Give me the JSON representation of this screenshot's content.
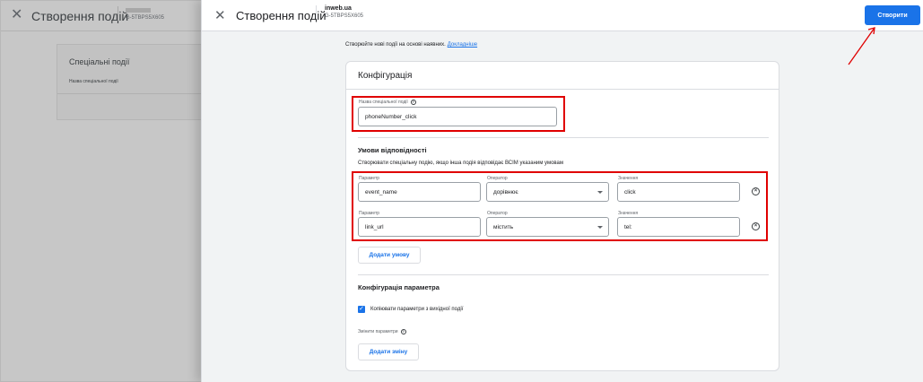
{
  "background": {
    "title": "Створення подій",
    "property_id": "G-5TBPS5X605",
    "card_title": "Спеціальні події",
    "card_label": "Назва спеціальної події"
  },
  "header": {
    "title": "Створення подій",
    "property_name": "inweb.ua",
    "property_id": "G-5TBPS5X605",
    "create_label": "Створити",
    "close_icon": "close-icon"
  },
  "intro": {
    "text": "Створюйте нові події на основі наявних.",
    "link": "Докладніше"
  },
  "configuration": {
    "title": "Конфігурація",
    "event_name_label": "Назва спеціальної події",
    "event_name_value": "phoneNumber_click"
  },
  "conditions": {
    "title": "Умови відповідності",
    "subtitle": "Створювати спеціальну подію, якщо інша подія відповідає ВСІМ указаним умовам",
    "rows": [
      {
        "param_label": "Параметр",
        "param": "event_name",
        "operator_label": "Оператор",
        "operator": "дорівнює",
        "value_label": "Значення",
        "value": "click"
      },
      {
        "param_label": "Параметр",
        "param": "link_url",
        "operator_label": "Оператор",
        "operator": "містить",
        "value_label": "Значення",
        "value": "tel:"
      }
    ],
    "add_condition_label": "Додати умову"
  },
  "param_config": {
    "title": "Конфігурація параметра",
    "copy_label": "Копіювати параметри з вихідної події",
    "copy_checked": true,
    "modify_label": "Змінити параметри",
    "add_change_label": "Додати зміну"
  },
  "colors": {
    "accent": "#1a73e8",
    "highlight": "#e00000"
  }
}
